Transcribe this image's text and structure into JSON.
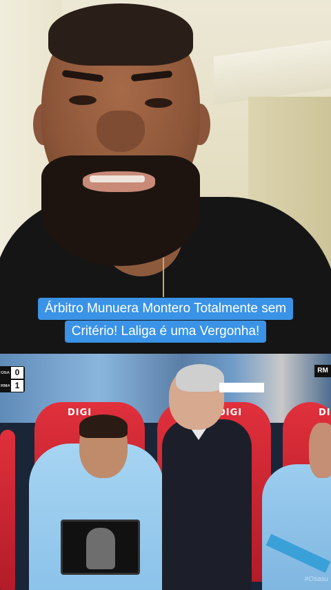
{
  "caption": {
    "line1": "Árbitro Munuera Montero Totalmente sem",
    "line2": "Critério! Laliga é uma Vergonha!",
    "background_color": "#3a93e6"
  },
  "match_overlay": {
    "scoreboard": [
      {
        "team": "OSA",
        "score": "0"
      },
      {
        "team": "RMA",
        "score": "1"
      }
    ],
    "channel_bug": "RM",
    "seat_branding": [
      "DIGI",
      "DIGI",
      "DIGI"
    ],
    "watermark": "#Osasu"
  }
}
